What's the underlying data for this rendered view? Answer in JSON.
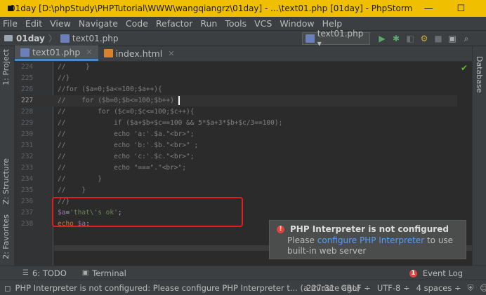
{
  "window": {
    "title": "01day [D:\\phpStudy\\PHPTutorial\\WWW\\wangqiangrz\\01day] - ...\\text01.php [01day] - PhpStorm",
    "minimize": "—",
    "maximize": "☐",
    "close": "✕"
  },
  "menu": [
    "File",
    "Edit",
    "View",
    "Navigate",
    "Code",
    "Refactor",
    "Run",
    "Tools",
    "VCS",
    "Window",
    "Help"
  ],
  "navbar": {
    "project": "01day",
    "file": "text01.php",
    "run_config": "text01.php ▾"
  },
  "tool_windows": {
    "left": [
      "1: Project",
      "Z: Structure",
      "2: Favorites"
    ],
    "right": "Database"
  },
  "tabs": [
    {
      "label": "text01.php",
      "active": true
    },
    {
      "label": "index.html",
      "active": false
    }
  ],
  "editor": {
    "lines": [
      {
        "n": "224",
        "text": "//     }",
        "style": "comment"
      },
      {
        "n": "225",
        "text": "//}",
        "style": "comment"
      },
      {
        "n": "226",
        "text": "//for ($a=0;$a<=100;$a++){",
        "style": "comment"
      },
      {
        "n": "227",
        "text": "//    for ($b=0;$b<=100;$b++)",
        "style": "comment",
        "current": true
      },
      {
        "n": "228",
        "text": "//        for ($c=0;$c<=100;$c++){",
        "style": "comment"
      },
      {
        "n": "229",
        "text": "//            if ($a+$b+$c==100 && 5*$a+3*$b+$c/3==100);",
        "style": "comment"
      },
      {
        "n": "230",
        "text": "//            echo 'a:'.$a.\"<br>\";",
        "style": "comment"
      },
      {
        "n": "231",
        "text": "//            echo 'b:'.$b.\"<br>\" ;",
        "style": "comment"
      },
      {
        "n": "232",
        "text": "//            echo 'c:'.$c.\"<br>\";",
        "style": "comment"
      },
      {
        "n": "233",
        "text": "//            echo \"===\".\"<br>\";",
        "style": "comment"
      },
      {
        "n": "234",
        "text": "//        }",
        "style": "comment"
      },
      {
        "n": "235",
        "text": "//    }",
        "style": "comment"
      },
      {
        "n": "236",
        "text": "//}",
        "style": "comment"
      },
      {
        "n": "237",
        "text": "",
        "style": "code1"
      },
      {
        "n": "238",
        "text": "",
        "style": "code2"
      }
    ],
    "code1": {
      "var": "$a",
      "op": "=",
      "str": "'that\\'s ok'",
      "end": ";"
    },
    "code2": {
      "kw": "echo",
      "var": "$a",
      "end": ";"
    }
  },
  "notification": {
    "title": "PHP Interpreter is not configured",
    "line1_prefix": "Please ",
    "link": "configure PHP Interpreter",
    "line1_suffix": " to use",
    "line2": "built-in web server"
  },
  "bottom_tabs": {
    "todo": "6: TODO",
    "terminal": "Terminal",
    "event_log": "Event Log"
  },
  "status": {
    "message": "PHP Interpreter is not configured: Please configure PHP Interpreter t... (a minute ago)",
    "position": "227:31",
    "line_sep": "CRLF ÷",
    "encoding": "UTF-8 ÷",
    "indent": "4 spaces ÷"
  }
}
